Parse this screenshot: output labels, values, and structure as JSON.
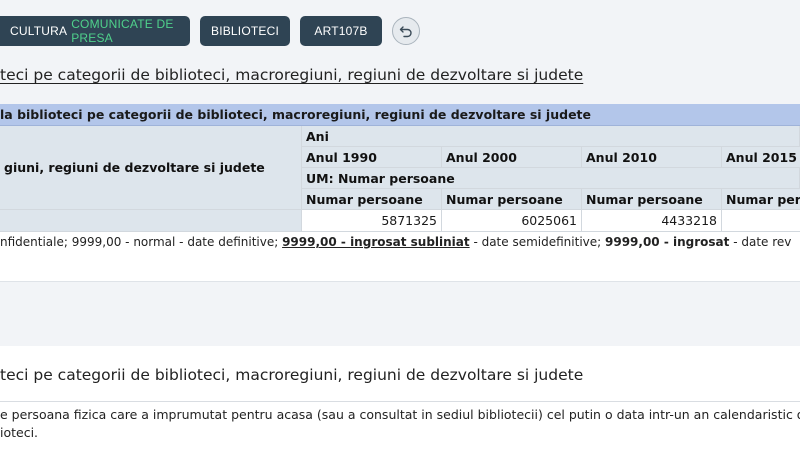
{
  "nav": {
    "crumb1_main": "CULTURA",
    "crumb1_accent": "COMUNICATE DE PRESA",
    "crumb2": "BIBLIOTECI",
    "crumb3": "ART107B",
    "back_icon": "undo-arrow-icon",
    "accent_color": "#4fd18b"
  },
  "page_title": "teci pe categorii de biblioteci, macroregiuni, regiuni de dezvoltare si judete",
  "table": {
    "caption": "la biblioteci pe categorii de biblioteci, macroregiuni, regiuni de dezvoltare si judete",
    "caption_bg": "#b3c6ea",
    "row_dimension_label": "giuni, regiuni de dezvoltare si judete",
    "ani_label": "Ani",
    "years": [
      "Anul 1990",
      "Anul 2000",
      "Anul 2010",
      "Anul 2015"
    ],
    "um_label": "UM: Numar persoane",
    "unit_headers": [
      "Numar persoane",
      "Numar persoane",
      "Numar persoane",
      "Numar persoane"
    ],
    "values": [
      "5871325",
      "6025061",
      "4433218",
      ""
    ]
  },
  "legend": {
    "part1": "nfidentiale; 9999,00 - normal - date definitive; ",
    "part2_bold_underline": "9999,00 - ingrosat subliniat",
    "part3": " - date semidefinitive; ",
    "part4_bold": "9999,00 - ingrosat",
    "part5": " - date rev"
  },
  "definition": {
    "title": "teci pe categorii de biblioteci, macroregiuni, regiuni de dezvoltare si judete",
    "line1": "e persoana fizica care a imprumutat pentru acasa (sau a consultat in sediul bibliotecii) cel putin o data intr-un an calendaristic o car",
    "line2": "ioteci."
  }
}
